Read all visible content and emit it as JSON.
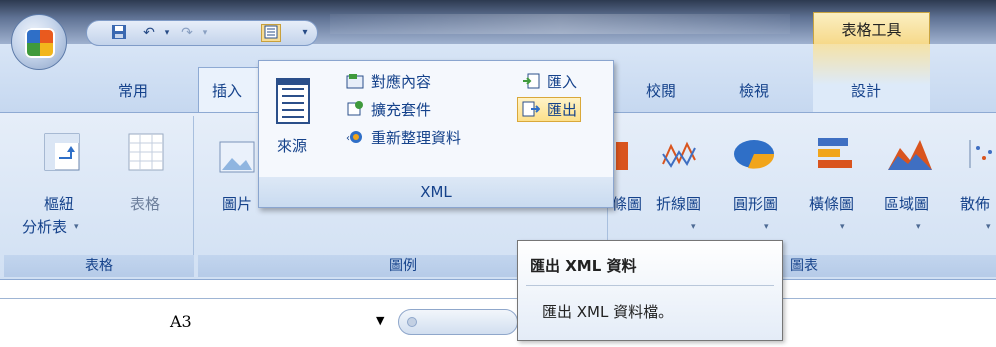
{
  "title_bar": {
    "contextual_group_label": "表格工具"
  },
  "tabs": [
    {
      "label": "常用"
    },
    {
      "label": "插入"
    },
    {
      "label": "校閱"
    },
    {
      "label": "檢視"
    },
    {
      "label": "設計"
    }
  ],
  "ribbon": {
    "table_group": {
      "pivot_label_line1": "樞紐",
      "pivot_label_line2": "分析表",
      "table_label": "表格",
      "group_label": "表格"
    },
    "illustration_group": {
      "picture_label": "圖片",
      "group_label": "圖例"
    },
    "chart_group": {
      "items": [
        {
          "label": "條圖"
        },
        {
          "label": "折線圖"
        },
        {
          "label": "圓形圖"
        },
        {
          "label": "橫條圖"
        },
        {
          "label": "區域圖"
        },
        {
          "label": "散佈"
        }
      ],
      "group_label": "圖表"
    }
  },
  "xml_panel": {
    "source_label": "來源",
    "items": [
      {
        "label": "對應內容",
        "icon": "map-properties-icon"
      },
      {
        "label": "擴充套件",
        "icon": "expansion-packs-icon"
      },
      {
        "label": "重新整理資料",
        "icon": "refresh-data-icon"
      }
    ],
    "import_label": "匯入",
    "export_label": "匯出",
    "footer_label": "XML"
  },
  "tooltip": {
    "title": "匯出 XML 資料",
    "description": "匯出 XML 資料檔。"
  },
  "formula_bar": {
    "name_box_value": "A3"
  },
  "colors": {
    "accent_text": "#15428b",
    "highlight": "#fde08a",
    "contextual_tab": "#f5e2a7"
  }
}
